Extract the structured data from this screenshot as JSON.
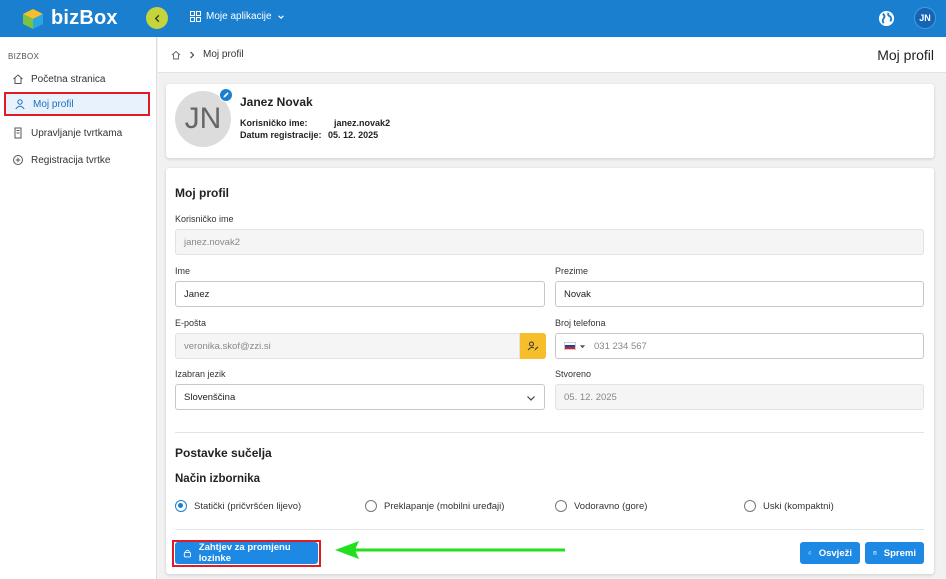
{
  "app": {
    "brand": "bizBox",
    "apps_menu_label": "Moje aplikacije",
    "user_initials": "JN"
  },
  "sidebar": {
    "section": "BIZBOX",
    "items": [
      {
        "label": "Početna stranica",
        "icon": "home-icon"
      },
      {
        "label": "Moj profil",
        "icon": "user-icon",
        "active": true
      },
      {
        "label": "Upravljanje tvrtkama",
        "icon": "building-icon"
      },
      {
        "label": "Registracija tvrtke",
        "icon": "plus-circle-icon"
      }
    ]
  },
  "breadcrumb": {
    "current": "Moj profil"
  },
  "page_title": "Moj profil",
  "profile": {
    "initials": "JN",
    "name": "Janez Novak",
    "username_label": "Korisničko ime:",
    "username": "janez.novak2",
    "registered_label": "Datum registracije:",
    "registered": "05. 12. 2025"
  },
  "form": {
    "heading": "Moj profil",
    "username": {
      "label": "Korisničko ime",
      "value": "janez.novak2"
    },
    "first_name": {
      "label": "Ime",
      "value": "Janez"
    },
    "last_name": {
      "label": "Prezime",
      "value": "Novak"
    },
    "email": {
      "label": "E-pošta",
      "value": "veronika.skof@zzi.si"
    },
    "phone": {
      "label": "Broj telefona",
      "value": "031 234 567"
    },
    "language": {
      "label": "Izabran jezik",
      "value": "Slovenščina"
    },
    "created": {
      "label": "Stvoreno",
      "value": "05. 12. 2025"
    }
  },
  "ui_settings": {
    "heading": "Postavke sučelja",
    "menu_heading": "Način izbornika",
    "options": [
      {
        "label": "Statički (pričvršćen lijevo)",
        "selected": true
      },
      {
        "label": "Preklapanje (mobilni uređaji)",
        "selected": false
      },
      {
        "label": "Vodoravno (gore)",
        "selected": false
      },
      {
        "label": "Uski (kompaktni)",
        "selected": false
      }
    ]
  },
  "actions": {
    "password_request": "Zahtjev za promjenu lozinke",
    "refresh": "Osvježi",
    "save": "Spremi"
  },
  "colors": {
    "primary": "#1b7fd0",
    "accent": "#c6d43c",
    "warning": "#f6be2a",
    "highlight": "#e01b24",
    "arrow": "#22e01e"
  }
}
